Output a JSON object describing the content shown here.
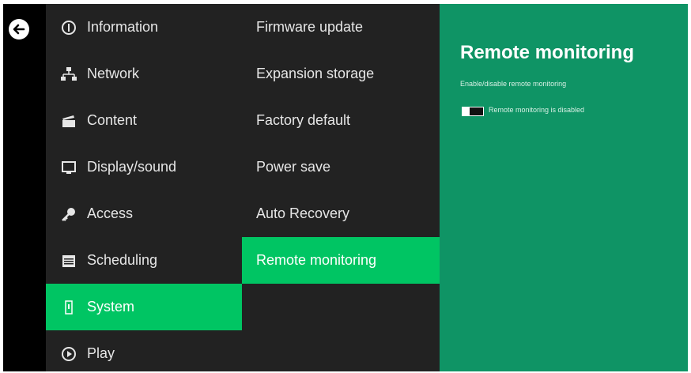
{
  "back": {
    "icon": "back-arrow-icon"
  },
  "menu": {
    "items": [
      {
        "label": "Information",
        "icon": "info-icon"
      },
      {
        "label": "Network",
        "icon": "network-icon"
      },
      {
        "label": "Content",
        "icon": "content-icon"
      },
      {
        "label": "Display/sound",
        "icon": "display-icon"
      },
      {
        "label": "Access",
        "icon": "key-icon"
      },
      {
        "label": "Scheduling",
        "icon": "calendar-icon"
      },
      {
        "label": "System",
        "icon": "system-icon",
        "active": true
      },
      {
        "label": "Play",
        "icon": "play-icon"
      }
    ]
  },
  "submenu": {
    "items": [
      {
        "label": "Firmware update"
      },
      {
        "label": "Expansion storage"
      },
      {
        "label": "Factory default"
      },
      {
        "label": "Power save"
      },
      {
        "label": "Auto Recovery"
      },
      {
        "label": "Remote monitoring",
        "active": true
      }
    ]
  },
  "panel": {
    "title": "Remote monitoring",
    "description": "Enable/disable remote monitoring",
    "toggle_label": "Remote monitoring is disabled",
    "toggle_state": "off"
  },
  "colors": {
    "accent": "#00c563",
    "panel_bg": "#0f9465",
    "menu_bg": "#222222",
    "sidebar_bg": "#000000"
  }
}
